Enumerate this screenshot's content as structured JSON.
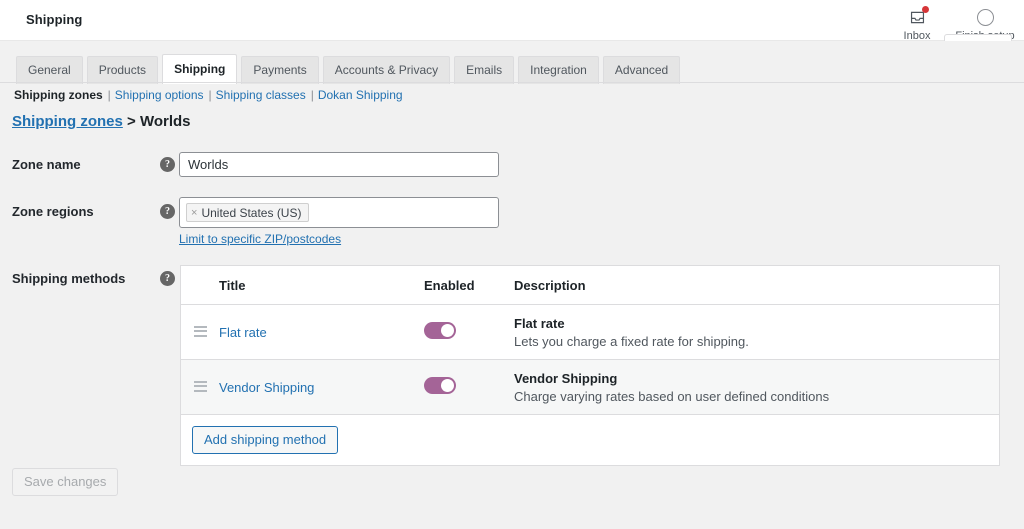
{
  "header": {
    "title": "Shipping",
    "actions": [
      {
        "label": "Inbox",
        "icon": "inbox-icon",
        "badge": true
      },
      {
        "label": "Finish setup",
        "icon": "progress-ring-icon",
        "badge": false
      }
    ]
  },
  "tabs": [
    {
      "label": "General",
      "active": false
    },
    {
      "label": "Products",
      "active": false
    },
    {
      "label": "Shipping",
      "active": true
    },
    {
      "label": "Payments",
      "active": false
    },
    {
      "label": "Accounts & Privacy",
      "active": false
    },
    {
      "label": "Emails",
      "active": false
    },
    {
      "label": "Integration",
      "active": false
    },
    {
      "label": "Advanced",
      "active": false
    }
  ],
  "subnav": {
    "current": "Shipping zones",
    "links": [
      "Shipping options",
      "Shipping classes",
      "Dokan Shipping"
    ],
    "separator": "|"
  },
  "breadcrumb": {
    "root": "Shipping zones",
    "separator": ">",
    "current": "Worlds"
  },
  "form": {
    "zone_name": {
      "label": "Zone name",
      "value": "Worlds",
      "placeholder": "Zone name",
      "help": "?"
    },
    "zone_regions": {
      "label": "Zone regions",
      "help": "?",
      "tags": [
        {
          "remove": "×",
          "label": "United States (US)"
        }
      ],
      "zip_link": "Limit to specific ZIP/postcodes"
    },
    "shipping_methods": {
      "label": "Shipping methods",
      "help": "?"
    }
  },
  "methods_table": {
    "columns": {
      "title": "Title",
      "enabled": "Enabled",
      "description": "Description"
    },
    "rows": [
      {
        "title": "Flat rate",
        "enabled": true,
        "desc_title": "Flat rate",
        "desc_text": "Lets you charge a fixed rate for shipping."
      },
      {
        "title": "Vendor Shipping",
        "enabled": true,
        "desc_title": "Vendor Shipping",
        "desc_text": "Charge varying rates based on user defined conditions"
      }
    ],
    "add_button": "Add shipping method"
  },
  "footer": {
    "save_button": "Save changes"
  },
  "colors": {
    "accent_link": "#2271b1",
    "toggle_on": "#a46497",
    "page_bg": "#f1f1f1",
    "notification": "#d63638"
  }
}
